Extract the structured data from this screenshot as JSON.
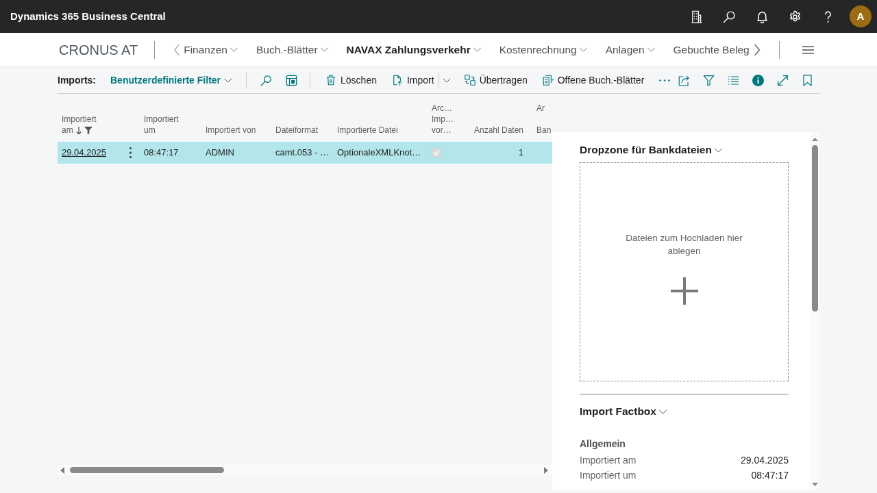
{
  "app_bar": {
    "title": "Dynamics 365 Business Central",
    "avatar": "A"
  },
  "navigation": {
    "company": "CRONUS AT",
    "items": [
      {
        "label": "Finanzen",
        "selected": false,
        "dropdown": true
      },
      {
        "label": "Buch.-Blätter",
        "selected": false,
        "dropdown": true
      },
      {
        "label": "NAVAX Zahlungsverkehr",
        "selected": true,
        "dropdown": true
      },
      {
        "label": "Kostenrechnung",
        "selected": false,
        "dropdown": true
      },
      {
        "label": "Anlagen",
        "selected": false,
        "dropdown": true
      },
      {
        "label": "Gebuchte Beleg",
        "selected": false,
        "dropdown": false
      }
    ]
  },
  "action_bar": {
    "caption": "Imports:",
    "filter": "Benutzerdefinierte Filter",
    "actions": [
      {
        "label": "Löschen",
        "split": false
      },
      {
        "label": "Import",
        "split": true
      },
      {
        "label": "Übertragen",
        "split": false
      },
      {
        "label": "Offene Buch.-Blätter",
        "split": false
      }
    ]
  },
  "list": {
    "columns": [
      {
        "lines": [
          "Importiert",
          "am"
        ],
        "right_aligned": false,
        "sorted_descending": true,
        "filtered": true,
        "cut": false
      },
      {
        "lines": [
          "Importiert",
          "um"
        ],
        "right_aligned": false,
        "sorted_descending": false,
        "filtered": false,
        "cut": false
      },
      {
        "lines": [
          "Importiert von"
        ],
        "right_aligned": false,
        "sorted_descending": false,
        "filtered": false,
        "cut": false
      },
      {
        "lines": [
          "Dateiformat"
        ],
        "right_aligned": false,
        "sorted_descending": false,
        "filtered": false,
        "cut": false
      },
      {
        "lines": [
          "Importierte Datei"
        ],
        "right_aligned": false,
        "sorted_descending": false,
        "filtered": false,
        "cut": false
      },
      {
        "lines": [
          "Arc…",
          "Imp…",
          "vor…"
        ],
        "right_aligned": false,
        "sorted_descending": false,
        "filtered": false,
        "cut": false
      },
      {
        "lines": [
          "Anzahl Daten"
        ],
        "right_aligned": true,
        "sorted_descending": false,
        "filtered": false,
        "cut": false
      },
      {
        "lines": [
          "Ar",
          "Ban"
        ],
        "right_aligned": false,
        "sorted_descending": false,
        "filtered": false,
        "cut": true
      }
    ],
    "rows": [
      {
        "selected": true,
        "cells": [
          {
            "kind": "link",
            "text": "29.04.2025"
          },
          {
            "kind": "text",
            "text": "08:47:17"
          },
          {
            "kind": "text",
            "text": "ADMIN"
          },
          {
            "kind": "text",
            "text": "camt.053 - …"
          },
          {
            "kind": "text",
            "text": "OptionaleXMLKnot…"
          },
          {
            "kind": "checkbox",
            "checked": true,
            "disabled": true
          },
          {
            "kind": "text",
            "text": "1"
          }
        ]
      }
    ]
  },
  "factbox_pane": {
    "parts": [
      {
        "kind": "dropzone",
        "title": "Dropzone für Bankdateien",
        "expanded": true,
        "hint": "Dateien zum Hochladen hier ablegen"
      },
      {
        "kind": "fields",
        "title": "Import Factbox",
        "expanded": true,
        "group": "Allgemein",
        "fields": [
          {
            "label": "Importiert am",
            "value": "29.04.2025"
          },
          {
            "label": "Importiert um",
            "value": "08:47:17"
          }
        ]
      }
    ]
  }
}
